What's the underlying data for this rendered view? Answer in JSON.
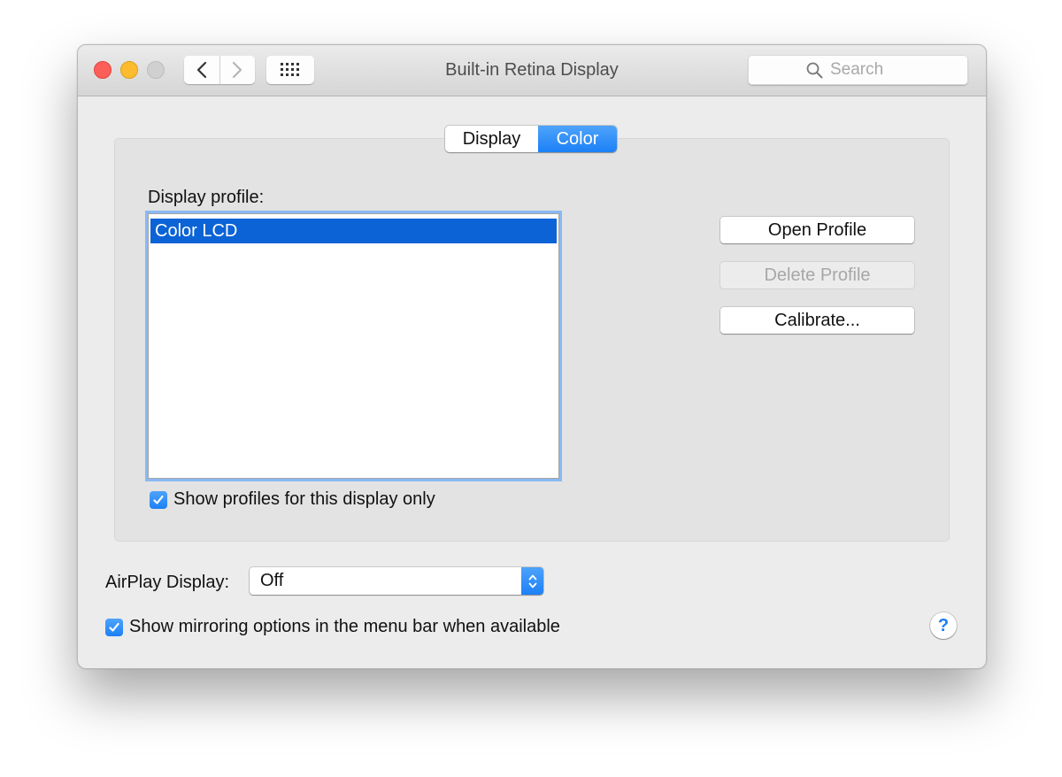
{
  "window": {
    "title": "Built-in Retina Display",
    "search_placeholder": "Search"
  },
  "tabs": [
    {
      "label": "Display",
      "selected": false
    },
    {
      "label": "Color",
      "selected": true
    }
  ],
  "color_tab": {
    "profile_label": "Display profile:",
    "profiles": [
      "Color LCD"
    ],
    "selected_profile": "Color LCD",
    "buttons": {
      "open": "Open Profile",
      "delete": "Delete Profile",
      "calibrate": "Calibrate..."
    },
    "show_profiles_checkbox": {
      "label": "Show profiles for this display only",
      "checked": true
    }
  },
  "airplay": {
    "label": "AirPlay Display:",
    "value": "Off"
  },
  "mirroring_checkbox": {
    "label": "Show mirroring options in the menu bar when available",
    "checked": true
  },
  "help": {
    "label": "?"
  },
  "colors": {
    "accent": "#1c80f6",
    "selection": "#0b63d6",
    "close": "#fc5f57",
    "minimize": "#fdbc2e"
  },
  "icons": {
    "back": "chevron-left-icon",
    "forward": "chevron-right-icon",
    "show_all": "grid-icon",
    "search": "magnifier-icon",
    "stepper": "up-down-chevron-icon",
    "check": "checkmark-icon"
  }
}
